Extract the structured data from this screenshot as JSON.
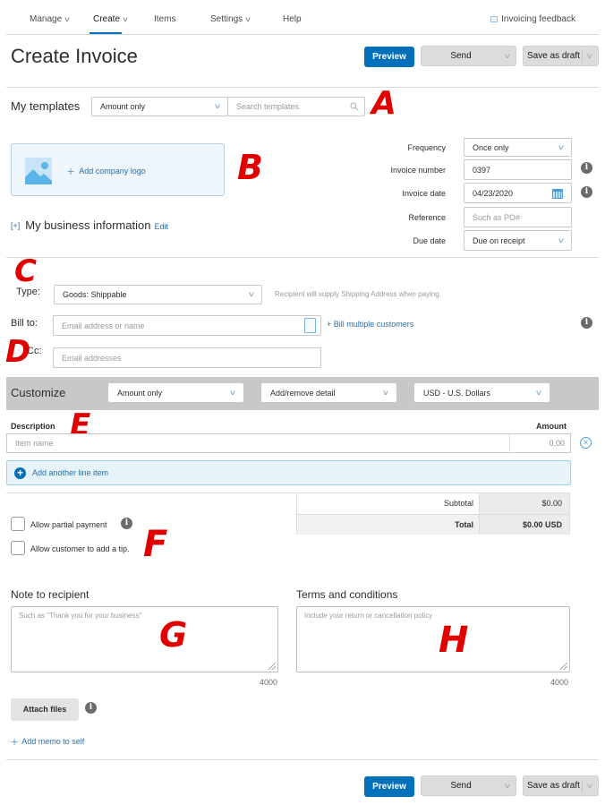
{
  "nav": {
    "items": [
      {
        "label": "Manage",
        "has_dropdown": true
      },
      {
        "label": "Create",
        "has_dropdown": true,
        "active": true
      },
      {
        "label": "Items",
        "has_dropdown": false
      },
      {
        "label": "Settings",
        "has_dropdown": true
      },
      {
        "label": "Help",
        "has_dropdown": false
      }
    ],
    "feedback_label": "Invoicing feedback",
    "chevron_glyph": "∨"
  },
  "header": {
    "title": "Create Invoice",
    "preview_label": "Preview",
    "send_label": "Send",
    "save_draft_label": "Save as draft"
  },
  "templates": {
    "label": "My templates",
    "selected": "Amount only",
    "search_placeholder": "Search templates"
  },
  "business": {
    "add_logo_label": "Add company logo",
    "info_toggle": "[+]",
    "info_label": "My business information",
    "edit_label": "Edit"
  },
  "invoice_meta": {
    "frequency_label": "Frequency",
    "frequency_value": "Once only",
    "invoice_number_label": "Invoice number",
    "invoice_number_value": "0397",
    "invoice_date_label": "Invoice date",
    "invoice_date_value": "04/23/2020",
    "reference_label": "Reference",
    "reference_placeholder": "Such as PO#",
    "due_date_label": "Due date",
    "due_date_value": "Due on receipt"
  },
  "recipient": {
    "type_label": "Type:",
    "type_value": "Goods: Shippable",
    "type_hint": "Recipient will supply Shipping Address when paying.",
    "bill_to_label": "Bill to:",
    "bill_to_placeholder": "Email address or name",
    "bill_multiple_label": "+ Bill multiple customers",
    "cc_label": "Cc:",
    "cc_placeholder": "Email addresses"
  },
  "customize": {
    "title": "Customize",
    "layout_value": "Amount only",
    "detail_value": "Add/remove detail",
    "currency_value": "USD - U.S. Dollars"
  },
  "line_items": {
    "description_header": "Description",
    "amount_header": "Amount",
    "rows": [
      {
        "name_placeholder": "Item name",
        "amount_placeholder": "0.00"
      }
    ],
    "add_line_label": "Add another line item"
  },
  "totals": {
    "subtotal_label": "Subtotal",
    "subtotal_value": "$0.00",
    "total_label": "Total",
    "total_value": "$0.00 USD"
  },
  "options": {
    "partial_payment_label": "Allow partial payment",
    "partial_payment_checked": false,
    "tip_label": "Allow customer to add a tip.",
    "tip_checked": false
  },
  "notes": {
    "note_label": "Note to recipient",
    "note_placeholder": "Such as \"Thank you for your business\"",
    "note_counter": "4000",
    "terms_label": "Terms and conditions",
    "terms_placeholder": "Include your return or cancellation policy",
    "terms_counter": "4000"
  },
  "footer": {
    "attach_label": "Attach files",
    "memo_label": "Add memo to self",
    "preview_label": "Preview",
    "send_label": "Send",
    "save_draft_label": "Save as draft"
  },
  "annotations": [
    "A",
    "B",
    "C",
    "D",
    "E",
    "F",
    "G",
    "H"
  ],
  "colors": {
    "primary": "#0070ba",
    "link": "#2a6ea6",
    "annotation": "#e00000",
    "customize_bar": "#c8c8c8"
  }
}
